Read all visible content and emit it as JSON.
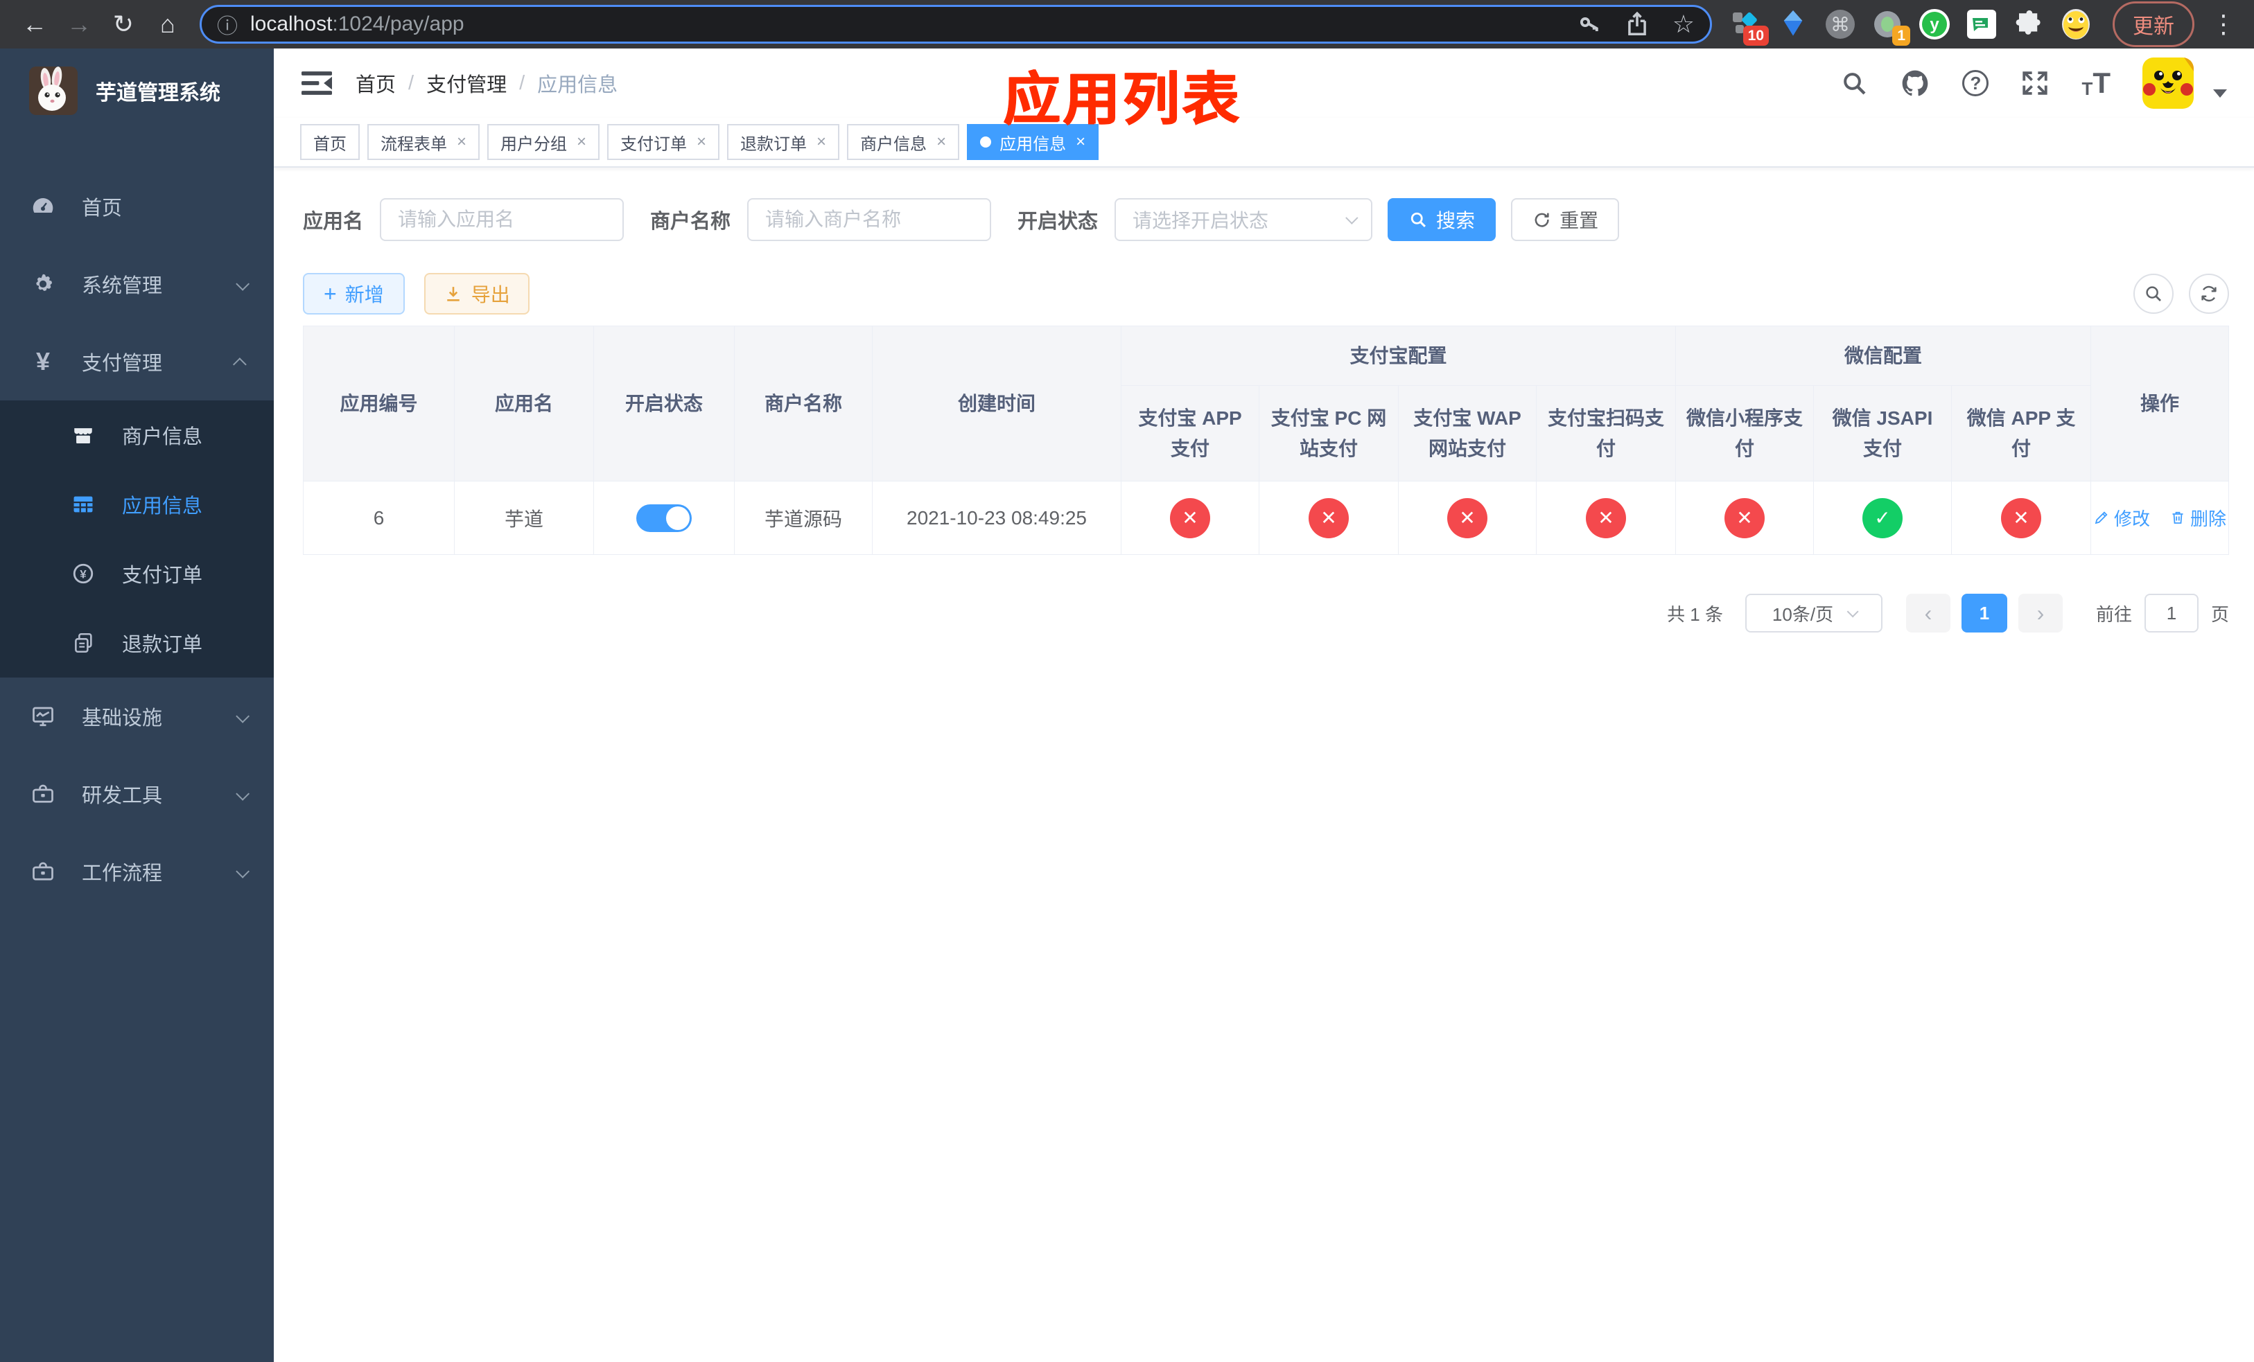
{
  "browser": {
    "url": {
      "host": "localhost",
      "path": ":1024/pay/app"
    },
    "update_label": "更新",
    "extension_badges": {
      "first": "10",
      "second": "1"
    },
    "icons": {
      "back": "←",
      "forward": "→",
      "reload": "↻",
      "home": "⌂",
      "info": "ⓘ",
      "star": "☆",
      "menu": "⋮",
      "command": "⌘"
    }
  },
  "sidebar": {
    "title": "芋道管理系统",
    "yuan_glyph": "¥",
    "items": [
      {
        "label": "首页"
      },
      {
        "label": "系统管理"
      },
      {
        "label": "支付管理"
      },
      {
        "label": "基础设施"
      },
      {
        "label": "研发工具"
      },
      {
        "label": "工作流程"
      }
    ],
    "submenu": [
      {
        "label": "商户信息",
        "active": false
      },
      {
        "label": "应用信息",
        "active": true
      },
      {
        "label": "支付订单",
        "active": false
      },
      {
        "label": "退款订单",
        "active": false
      }
    ]
  },
  "navbar": {
    "breadcrumb": [
      {
        "label": "首页"
      },
      {
        "label": "支付管理"
      },
      {
        "label": "应用信息"
      }
    ],
    "separator": "/",
    "help_glyph": "?"
  },
  "annotation": "应用列表",
  "close_glyph": "×",
  "tabs": [
    {
      "label": "首页",
      "closable": false,
      "active": false
    },
    {
      "label": "流程表单",
      "closable": true,
      "active": false
    },
    {
      "label": "用户分组",
      "closable": true,
      "active": false
    },
    {
      "label": "支付订单",
      "closable": true,
      "active": false
    },
    {
      "label": "退款订单",
      "closable": true,
      "active": false
    },
    {
      "label": "商户信息",
      "closable": true,
      "active": false
    },
    {
      "label": "应用信息",
      "closable": true,
      "active": true
    }
  ],
  "filters": {
    "app_name": {
      "label": "应用名",
      "placeholder": "请输入应用名",
      "value": ""
    },
    "merchant_name": {
      "label": "商户名称",
      "placeholder": "请输入商户名称",
      "value": ""
    },
    "status": {
      "label": "开启状态",
      "placeholder": "请选择开启状态",
      "value": ""
    },
    "search_label": "搜索",
    "reset_label": "重置"
  },
  "toolbar": {
    "add_label": "新增",
    "export_label": "导出",
    "plus_glyph": "+"
  },
  "table": {
    "columns": {
      "simple": [
        "应用编号",
        "应用名",
        "开启状态",
        "商户名称",
        "创建时间"
      ],
      "groups": [
        {
          "label": "支付宝配置",
          "children": [
            "支付宝 APP 支付",
            "支付宝 PC 网站支付",
            "支付宝 WAP 网站支付",
            "支付宝扫码支付"
          ]
        },
        {
          "label": "微信配置",
          "children": [
            "微信小程序支付",
            "微信 JSAPI 支付",
            "微信 APP 支付"
          ]
        }
      ],
      "action": "操作"
    },
    "row": {
      "app_id": "6",
      "app_name": "芋道",
      "enabled": "on",
      "merchant_name": "芋道源码",
      "created_at": "2021-10-23 08:49:25",
      "pay_statuses": [
        "no",
        "no",
        "no",
        "no",
        "no",
        "yes",
        "no"
      ],
      "edit_label": "修改",
      "delete_label": "删除"
    }
  },
  "pagination": {
    "total": "共 1 条",
    "page_size": "10条/页",
    "prev_glyph": "‹",
    "next_glyph": "›",
    "current_page": "1",
    "goto_label": "前往",
    "goto_value": "1",
    "page_unit": "页"
  },
  "colors": {
    "accent": "#409eff",
    "success": "#13ce66",
    "danger": "#f4494d",
    "warning": "#e6a23c",
    "sidebar_bg": "#304156",
    "submenu_bg": "#1f2d3d",
    "annotation_red": "#ff2b00"
  }
}
